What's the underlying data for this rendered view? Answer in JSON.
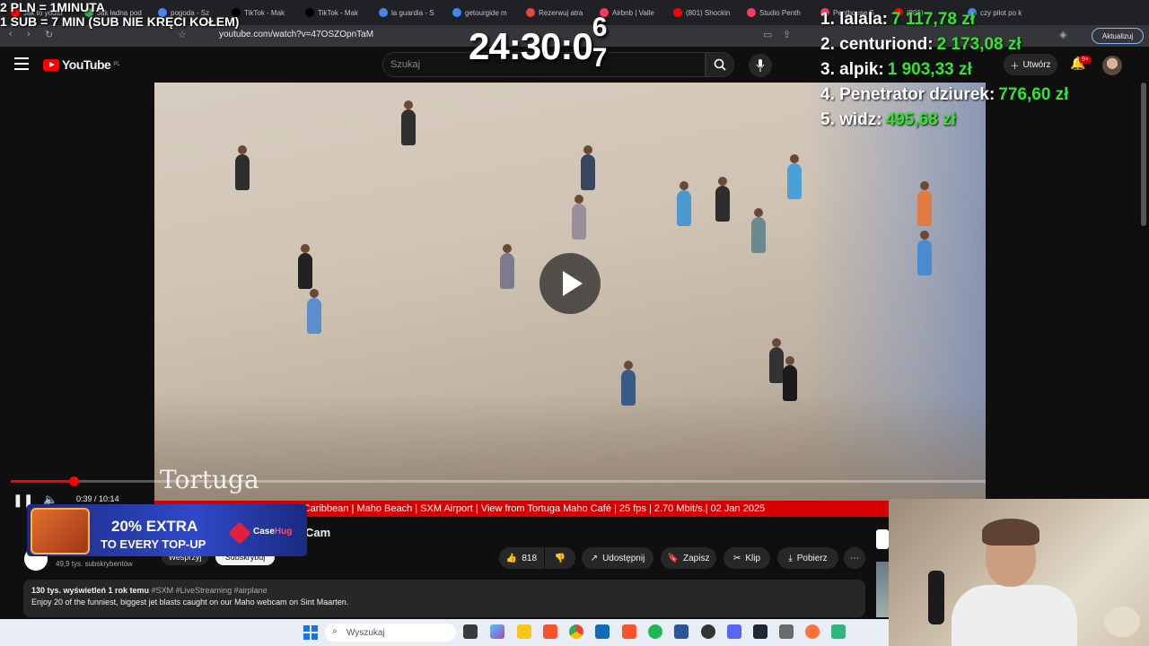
{
  "browser": {
    "tabs": [
      {
        "label": "Jak to youtu",
        "color": "#ff0000"
      },
      {
        "label": "Jak ładna pod",
        "color": "#34a853"
      },
      {
        "label": "pogoda - Sz",
        "color": "#4285f4"
      },
      {
        "label": "TikTok - Mak",
        "color": "#000000"
      },
      {
        "label": "TikTok - Mak",
        "color": "#000000"
      },
      {
        "label": "la guardia - S",
        "color": "#4285f4"
      },
      {
        "label": "getourgide m",
        "color": "#4285f4"
      },
      {
        "label": "Rezerwuj atra",
        "color": "#e8453c"
      },
      {
        "label": "Airbnb | Valle",
        "color": "#ff385c"
      },
      {
        "label": "(801) Shockin",
        "color": "#ff0000"
      },
      {
        "label": "Studio Penth",
        "color": "#ff385c"
      },
      {
        "label": "Penthouse S",
        "color": "#ff385c"
      },
      {
        "label": "(801)",
        "color": "#ff0000"
      },
      {
        "label": "czy pilot po k",
        "color": "#4285f4"
      }
    ],
    "url": "youtube.com/watch?v=47OSZOpnTaM",
    "update_label": "Aktualizuj"
  },
  "stream_overlay": {
    "rate_line1": "2 PLN = 1MINUTA",
    "rate_line2": "1 SUB = 7 MIN (SUB NIE KRĘCI KOŁEM)",
    "timer_main": "24:30:0",
    "timer_sup": "6",
    "timer_sub": "7",
    "leaderboard": [
      {
        "name": "1. lalala:",
        "amount": "7 117,78 zł"
      },
      {
        "name": "2. centuriond:",
        "amount": "2 173,08 zł"
      },
      {
        "name": "3. alpik:",
        "amount": "1 903,33 zł"
      },
      {
        "name": "4. Penetrator dziurek:",
        "amount": "776,60 zł"
      },
      {
        "name": "5. widz:",
        "amount": "495,68 zł"
      }
    ]
  },
  "youtube": {
    "logo": "YouTube",
    "logo_region": "PL",
    "search_placeholder": "Szukaj",
    "create_label": "Utwórz",
    "notif_count": "9+"
  },
  "player": {
    "watermark": "Tortuga",
    "time_current": "0:39",
    "time_total": "10:14",
    "progress": 0.064
  },
  "ticker_text": "• LIVE WEBCAM • by SHOWME Caribbean | Maho Beach | SXM Airport | View from Tortuga Maho Café | 25 fps | 2.70 Mbit/s.| 02 Jan 2025",
  "video_info": {
    "title_tail": "Cam",
    "subscribers": "49,9 tys. subskrybentów",
    "join_label": "Wesprzyj",
    "subscribe_label": "Subskrybuj",
    "likes": "818",
    "share_label": "Udostępnij",
    "save_label": "Zapisz",
    "clip_label": "Klip",
    "download_label": "Pobierz",
    "views_line": "130 tys. wyświetleń  1 rok temu",
    "tags": "#SXM #LiveStreaming #airplane",
    "description": "Enjoy 20 of the funniest, biggest jet blasts caught on our Maho webcam on Sint Maarten."
  },
  "ad": {
    "line1": "20% EXTRA",
    "line2": "TO EVERY TOP-UP",
    "brand_a": "Case",
    "brand_b": "Hug"
  },
  "taskbar": {
    "search_placeholder": "Wyszukaj"
  }
}
